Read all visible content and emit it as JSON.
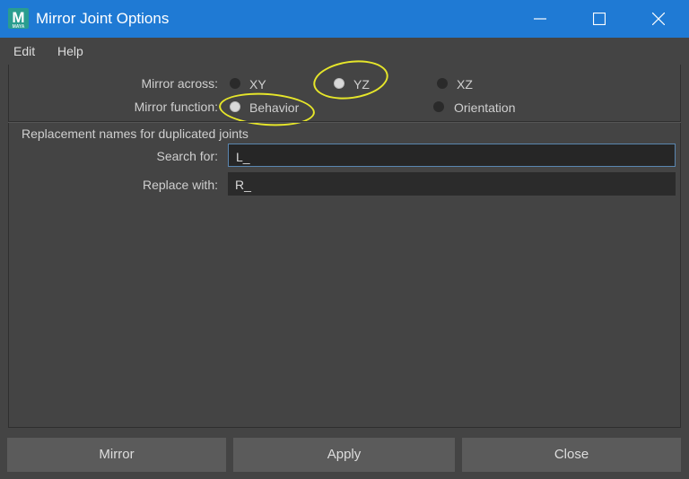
{
  "window": {
    "title": "Mirror Joint Options",
    "app_icon_letter": "M"
  },
  "menubar": {
    "items": [
      "Edit",
      "Help"
    ]
  },
  "mirror_across": {
    "label": "Mirror across:",
    "options": [
      {
        "label": "XY",
        "selected": false
      },
      {
        "label": "YZ",
        "selected": true
      },
      {
        "label": "XZ",
        "selected": false
      }
    ]
  },
  "mirror_function": {
    "label": "Mirror function:",
    "options": [
      {
        "label": "Behavior",
        "selected": true
      },
      {
        "label": "Orientation",
        "selected": false
      }
    ]
  },
  "replacement": {
    "section_label": "Replacement names for duplicated joints",
    "search_label": "Search for:",
    "search_value": "L_",
    "replace_label": "Replace with:",
    "replace_value": "R_"
  },
  "buttons": {
    "mirror": "Mirror",
    "apply": "Apply",
    "close": "Close"
  },
  "colors": {
    "titlebar": "#1f7ad4",
    "background": "#444444",
    "button": "#5b5b5b",
    "annotation": "#e6e62a"
  }
}
